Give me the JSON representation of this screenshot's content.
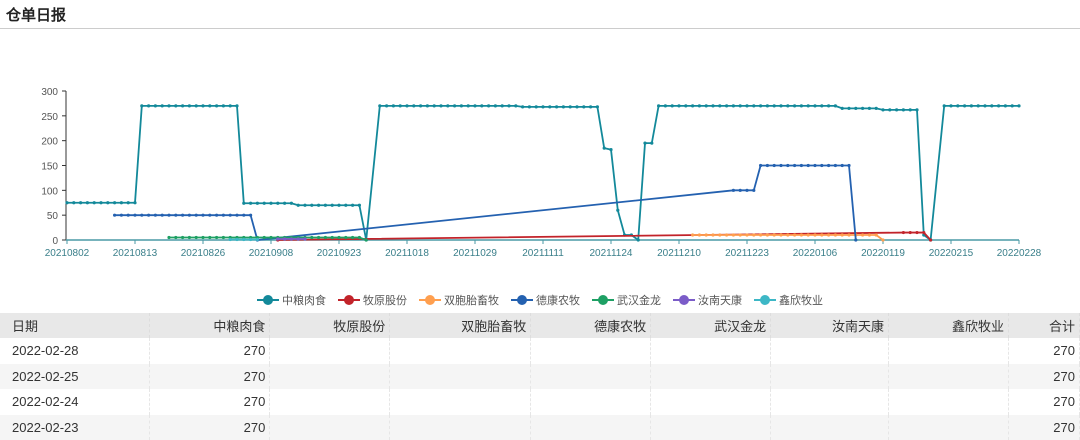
{
  "page": {
    "title": "仓单日报"
  },
  "chart_data": {
    "type": "line",
    "x_tick_labels": [
      "20210802",
      "20210813",
      "20210826",
      "20210908",
      "20210923",
      "20211018",
      "20211029",
      "20211111",
      "20211124",
      "20211210",
      "20211223",
      "20220106",
      "20220119",
      "20220215",
      "20220228"
    ],
    "x_points_per_tick": 10,
    "ylim": [
      0,
      300
    ],
    "y_ticks": [
      0,
      50,
      100,
      150,
      200,
      250,
      300
    ],
    "legend_position": "bottom",
    "series": [
      {
        "name": "中粮肉食",
        "color": "#13899a",
        "runs": [
          [
            0,
            10,
            75
          ],
          [
            11,
            25,
            270
          ],
          [
            26,
            33,
            74
          ],
          [
            34,
            43,
            70
          ],
          [
            44,
            44,
            0
          ],
          [
            46,
            66,
            270
          ],
          [
            67,
            78,
            268
          ],
          [
            79,
            79,
            185
          ],
          [
            80,
            80,
            182
          ],
          [
            81,
            81,
            60
          ],
          [
            82,
            83,
            10
          ],
          [
            84,
            84,
            0
          ],
          [
            85,
            86,
            195
          ],
          [
            87,
            113,
            270
          ],
          [
            114,
            119,
            265
          ],
          [
            120,
            125,
            262
          ],
          [
            126,
            126,
            10
          ],
          [
            127,
            127,
            0
          ],
          [
            129,
            140,
            270
          ]
        ]
      },
      {
        "name": "牧原股份",
        "color": "#c2232a",
        "runs": [
          [
            31,
            31,
            0
          ],
          [
            123,
            126,
            15
          ],
          [
            127,
            127,
            0
          ]
        ]
      },
      {
        "name": "双胞胎畜牧",
        "color": "#ff9f4f",
        "runs": [
          [
            92,
            119,
            10
          ],
          [
            120,
            120,
            0
          ]
        ]
      },
      {
        "name": "德康农牧",
        "color": "#2461b0",
        "runs": [
          [
            7,
            27,
            50
          ],
          [
            28,
            28,
            0
          ],
          [
            98,
            101,
            100
          ],
          [
            102,
            115,
            150
          ],
          [
            116,
            116,
            0
          ]
        ]
      },
      {
        "name": "武汉金龙",
        "color": "#1ea064",
        "runs": [
          [
            15,
            43,
            5
          ],
          [
            44,
            44,
            0
          ]
        ]
      },
      {
        "name": "汝南天康",
        "color": "#7b5cc8",
        "runs": [
          [
            31,
            35,
            2
          ]
        ]
      },
      {
        "name": "鑫欣牧业",
        "color": "#3db7c6",
        "runs": [
          [
            24,
            28,
            1
          ]
        ]
      }
    ]
  },
  "table": {
    "headers": [
      "日期",
      "中粮肉食",
      "牧原股份",
      "双胞胎畜牧",
      "德康农牧",
      "武汉金龙",
      "汝南天康",
      "鑫欣牧业",
      "合计"
    ],
    "rows": [
      [
        "2022-02-28",
        "270",
        "",
        "",
        "",
        "",
        "",
        "",
        "270"
      ],
      [
        "2022-02-25",
        "270",
        "",
        "",
        "",
        "",
        "",
        "",
        "270"
      ],
      [
        "2022-02-24",
        "270",
        "",
        "",
        "",
        "",
        "",
        "",
        "270"
      ],
      [
        "2022-02-23",
        "270",
        "",
        "",
        "",
        "",
        "",
        "",
        "270"
      ]
    ]
  }
}
